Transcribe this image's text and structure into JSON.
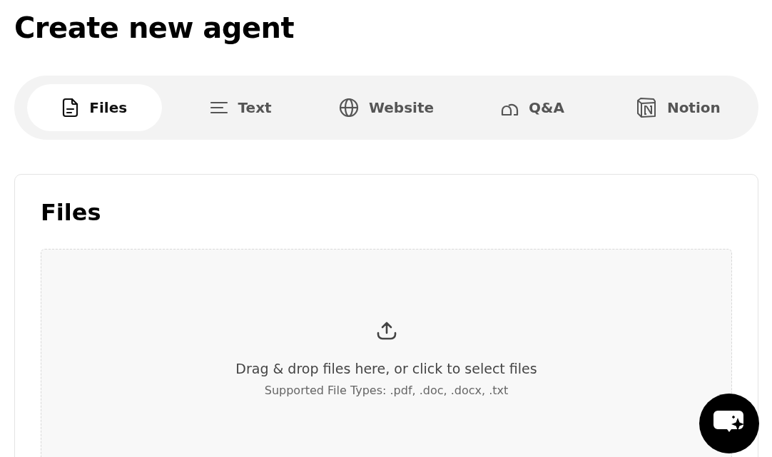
{
  "title": "Create new agent",
  "tabs": [
    {
      "label": "Files",
      "kind": "file",
      "selected": true
    },
    {
      "label": "Text",
      "kind": "text",
      "selected": false
    },
    {
      "label": "Website",
      "kind": "globe",
      "selected": false
    },
    {
      "label": "Q&A",
      "kind": "qa",
      "selected": false
    },
    {
      "label": "Notion",
      "kind": "notion",
      "selected": false
    }
  ],
  "panel": {
    "heading": "Files",
    "dropzone": {
      "prompt": "Drag & drop files here, or click to select files",
      "hint": "Supported File Types: .pdf, .doc, .docx, .txt"
    }
  }
}
